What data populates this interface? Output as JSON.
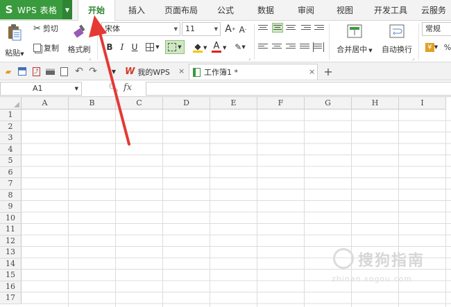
{
  "app": {
    "logo": "S",
    "title": "WPS 表格",
    "dropdown_icon": "triangle-down"
  },
  "menu": {
    "tabs": [
      {
        "label": "开始",
        "active": true
      },
      {
        "label": "插入",
        "active": false
      },
      {
        "label": "页面布局",
        "active": false
      },
      {
        "label": "公式",
        "active": false
      },
      {
        "label": "数据",
        "active": false
      },
      {
        "label": "审阅",
        "active": false
      },
      {
        "label": "视图",
        "active": false
      },
      {
        "label": "开发工具",
        "active": false
      },
      {
        "label": "云服务",
        "active": false
      }
    ]
  },
  "ribbon": {
    "paste_label": "粘贴",
    "cut_label": "剪切",
    "copy_label": "复制",
    "format_painter_label": "格式刷",
    "font_name": "宋体",
    "font_size": "11",
    "grow_font": "A",
    "shrink_font": "A",
    "bold": "B",
    "italic": "I",
    "underline": "U",
    "font_color_letter": "A",
    "merge_center_label": "合并居中",
    "wrap_text_label": "自动换行",
    "number_format": "常规",
    "percent": "%"
  },
  "quickbar": {
    "tabs": [
      {
        "label": "我的WPS",
        "active": false,
        "close": "×"
      },
      {
        "label": "工作簿1 *",
        "active": true,
        "close": "×"
      }
    ],
    "new_tab": "+"
  },
  "formula_bar": {
    "cell_ref": "A1",
    "fx_label": "fx",
    "value": ""
  },
  "sheet": {
    "columns": [
      "A",
      "B",
      "C",
      "D",
      "E",
      "F",
      "G",
      "H",
      "I"
    ],
    "rows": [
      "1",
      "2",
      "3",
      "4",
      "5",
      "6",
      "7",
      "8",
      "9",
      "10",
      "11",
      "12",
      "13",
      "14",
      "15",
      "16",
      "17"
    ]
  },
  "watermark": {
    "text": "搜狗指南",
    "url": "zhinan.sogou.com"
  },
  "colors": {
    "brand_green": "#3a9a3e",
    "active_tab_text": "#2f8533",
    "annotation_arrow": "#e53935"
  }
}
